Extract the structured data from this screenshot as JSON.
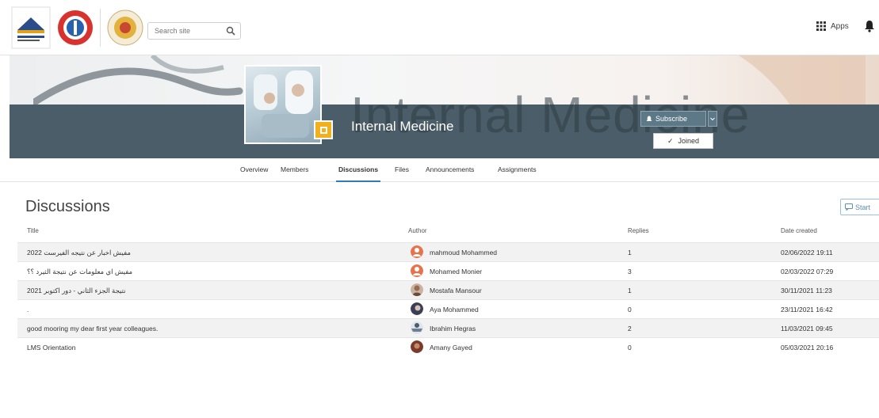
{
  "header": {
    "search_placeholder": "Search site",
    "apps_label": "Apps"
  },
  "course": {
    "title": "Internal Medicine",
    "banner_text": "Internal Medicine",
    "subscribe_label": "Subscribe",
    "joined_label": "Joined"
  },
  "tabs": [
    {
      "label": "Overview"
    },
    {
      "label": "Members"
    },
    {
      "label": "Discussions"
    },
    {
      "label": "Files"
    },
    {
      "label": "Announcements"
    },
    {
      "label": "Assignments"
    }
  ],
  "active_tab": "Discussions",
  "discussions": {
    "heading": "Discussions",
    "start_label": "Start",
    "columns": {
      "title": "Title",
      "author": "Author",
      "replies": "Replies",
      "date": "Date created"
    },
    "rows": [
      {
        "title": "مفيش اخبار عن نتيجه الفيرست 2022",
        "author": "mahmoud Mohammed",
        "replies": "1",
        "date": "02/06/2022 19:11",
        "avatar_color": "#e8734a"
      },
      {
        "title": "مفيش اي معلومات عن نتيجة الثيرد ؟؟",
        "author": "Mohamed Monier",
        "replies": "3",
        "date": "02/03/2022 07:29",
        "avatar_color": "#e8734a"
      },
      {
        "title": "نتيجة الجزء الثاني - دور اكتوبر 2021",
        "author": "Mostafa Mansour",
        "replies": "1",
        "date": "30/11/2021 11:23",
        "avatar_color": "#9a6b4f"
      },
      {
        "title": ".",
        "author": "Aya Mohammed",
        "replies": "0",
        "date": "23/11/2021 16:42",
        "avatar_color": "#3b3f55"
      },
      {
        "title": "good mooring my dear first year colleagues.",
        "author": "Ibrahim Hegras",
        "replies": "2",
        "date": "11/03/2021 09:45",
        "avatar_color": "#6d7f93"
      },
      {
        "title": "LMS Orientation",
        "author": "Amany Gayed",
        "replies": "0",
        "date": "05/03/2021 20:16",
        "avatar_color": "#7a3b2a"
      }
    ]
  },
  "colors": {
    "banner_band": "#4a5d68",
    "accent": "#2e7db6",
    "badge": "#f2b01e"
  }
}
